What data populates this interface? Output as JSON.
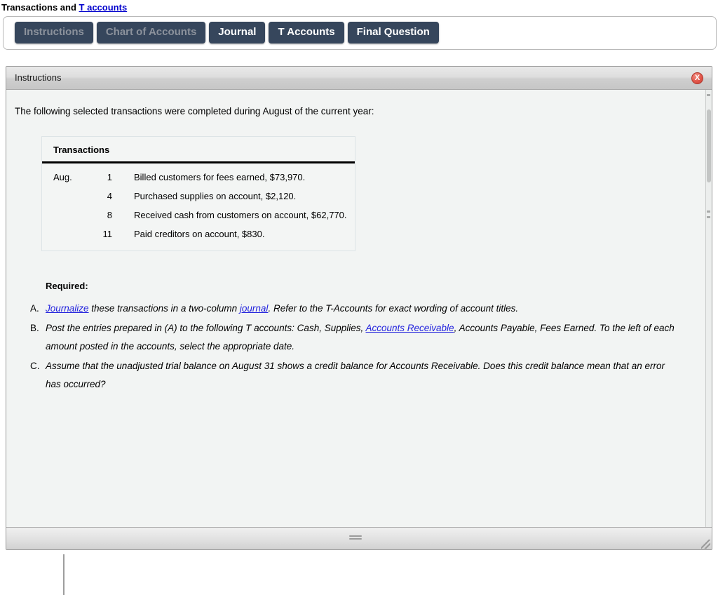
{
  "page": {
    "title_prefix": "Transactions and ",
    "title_link": "T accounts"
  },
  "tabs": [
    {
      "label": "Instructions",
      "state": "disabled"
    },
    {
      "label": "Chart of Accounts",
      "state": "disabled"
    },
    {
      "label": "Journal",
      "state": "enabled"
    },
    {
      "label": "T Accounts",
      "state": "enabled"
    },
    {
      "label": "Final Question",
      "state": "enabled"
    }
  ],
  "panel": {
    "title": "Instructions",
    "close_label": "X",
    "intro": "The following selected transactions were completed during August of the current year:"
  },
  "transactions_table": {
    "header": "Transactions",
    "rows": [
      {
        "month": "Aug.",
        "day": "1",
        "description": "Billed customers for fees earned, $73,970."
      },
      {
        "month": "",
        "day": "4",
        "description": "Purchased supplies on account, $2,120."
      },
      {
        "month": "",
        "day": "8",
        "description": "Received cash from customers on account, $62,770."
      },
      {
        "month": "",
        "day": "11",
        "description": "Paid creditors on account, $830."
      }
    ]
  },
  "required": {
    "label": "Required:",
    "items": [
      {
        "marker": "A.",
        "segments": [
          {
            "text": "Journalize",
            "link": true
          },
          {
            "text": " these transactions in a two-column ",
            "link": false
          },
          {
            "text": "journal",
            "link": true
          },
          {
            "text": ". Refer to the T-Accounts for exact wording of account titles.",
            "link": false
          }
        ]
      },
      {
        "marker": "B.",
        "segments": [
          {
            "text": "Post the entries prepared in (A) to the following T accounts: Cash, Supplies, ",
            "link": false
          },
          {
            "text": "Accounts Receivable",
            "link": true
          },
          {
            "text": ", Accounts Payable, Fees Earned. To the left of each amount posted in the accounts, select the appropriate date.",
            "link": false
          }
        ]
      },
      {
        "marker": "C.",
        "segments": [
          {
            "text": "Assume that the unadjusted trial balance on August 31 shows a credit balance for Accounts Receivable. Does this credit balance mean that an error has occurred?",
            "link": false
          }
        ]
      }
    ]
  },
  "colors": {
    "tab_background": "#36465c",
    "tab_text_enabled": "#ffffff",
    "tab_text_disabled": "#8c929c",
    "link": "#0000cc",
    "inline_link": "#2222dd",
    "panel_background": "#f2f4f3",
    "close_button": "#e2564a"
  }
}
